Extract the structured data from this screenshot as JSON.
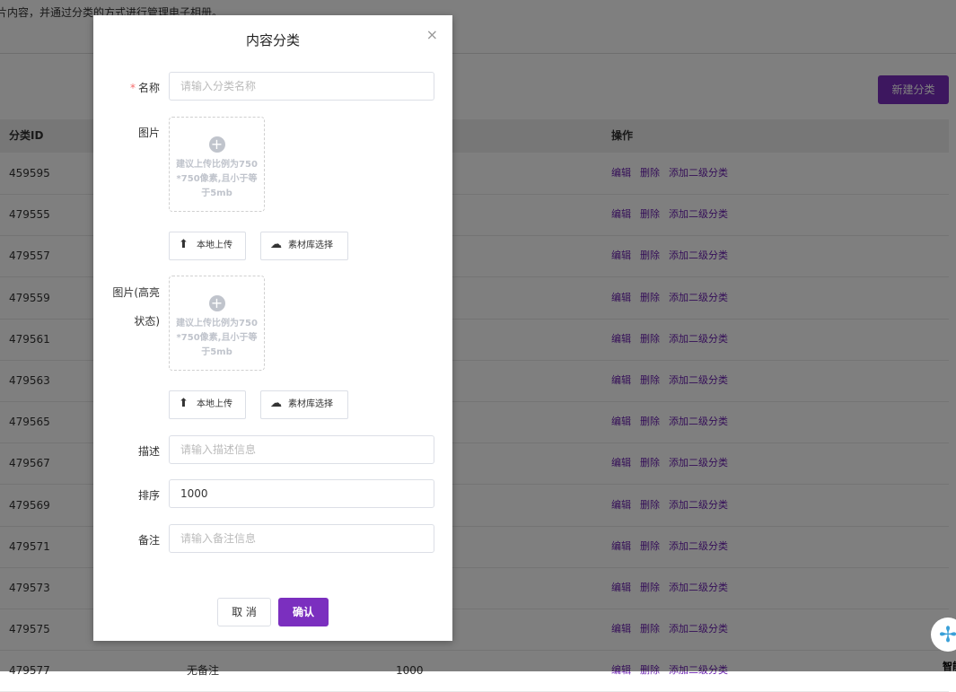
{
  "page": {
    "description": "片内容，并通过分类的方式进行管理电子相册。",
    "new_button": "新建分类"
  },
  "table": {
    "headers": {
      "id": "分类ID",
      "ops": "操作"
    },
    "ops": {
      "edit": "编辑",
      "delete": "删除",
      "add_sub": "添加二级分类"
    },
    "rows": [
      {
        "id": "459595"
      },
      {
        "id": "479555"
      },
      {
        "id": "479557"
      },
      {
        "id": "479559"
      },
      {
        "id": "479561"
      },
      {
        "id": "479563"
      },
      {
        "id": "479565"
      },
      {
        "id": "479567"
      },
      {
        "id": "479569"
      },
      {
        "id": "479571"
      },
      {
        "id": "479573"
      },
      {
        "id": "479575"
      },
      {
        "id": "479577",
        "remark": "无备注",
        "sort": "1000"
      }
    ]
  },
  "dialog": {
    "title": "内容分类",
    "close": "×",
    "name_label": "名称",
    "name_placeholder": "请输入分类名称",
    "image_label": "图片",
    "image_hint": [
      "建议上传比例为750",
      "*750像素,且小于等",
      "于5mb"
    ],
    "image_hl_label_1": "图片(高亮",
    "image_hl_label_2": "状态)",
    "local_upload": "本地上传",
    "library_select": "素材库选择",
    "desc_label": "描述",
    "desc_placeholder": "请输入描述信息",
    "sort_label": "排序",
    "sort_value": "1000",
    "remark_label": "备注",
    "remark_placeholder": "请输入备注信息",
    "cancel": "取 消",
    "confirm": "确认"
  },
  "assistant": {
    "label": "智能"
  }
}
